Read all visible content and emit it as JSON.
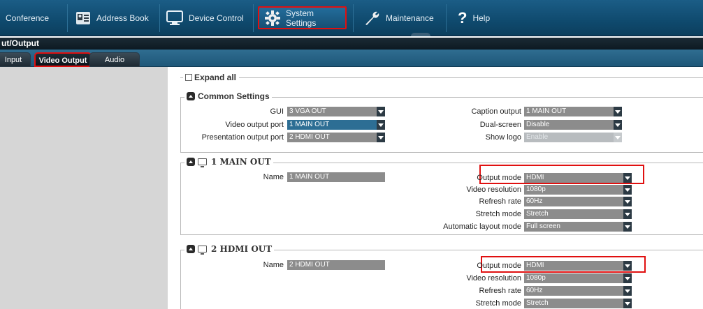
{
  "nav": {
    "conference": "Conference",
    "address_book": "Address Book",
    "device_control": "Device Control",
    "system_settings": "System Settings",
    "maintenance": "Maintenance",
    "help": "Help"
  },
  "page_title": "ut/Output",
  "tabs": {
    "input": "Input",
    "video_output": "Video Output",
    "audio": "Audio"
  },
  "expand_all": "Expand all",
  "common": {
    "legend": "Common Settings",
    "gui_label": "GUI",
    "gui_value": "3 VGA OUT",
    "video_output_port_label": "Video output port",
    "video_output_port_value": "1 MAIN OUT",
    "presentation_output_port_label": "Presentation output port",
    "presentation_output_port_value": "2 HDMI OUT",
    "caption_output_label": "Caption output",
    "caption_output_value": "1 MAIN OUT",
    "dual_screen_label": "Dual-screen",
    "dual_screen_value": "Disable",
    "show_logo_label": "Show logo",
    "show_logo_value": "Enable"
  },
  "main_out": {
    "legend": "1 MAIN OUT",
    "name_label": "Name",
    "name_value": "1 MAIN OUT",
    "output_mode_label": "Output mode",
    "output_mode_value": "HDMI",
    "video_resolution_label": "Video resolution",
    "video_resolution_value": "1080p",
    "refresh_rate_label": "Refresh rate",
    "refresh_rate_value": "60Hz",
    "stretch_mode_label": "Stretch mode",
    "stretch_mode_value": "Stretch",
    "auto_layout_label": "Automatic layout mode",
    "auto_layout_value": "Full screen"
  },
  "hdmi_out": {
    "legend": "2 HDMI OUT",
    "name_label": "Name",
    "name_value": "2 HDMI OUT",
    "output_mode_label": "Output mode",
    "output_mode_value": "HDMI",
    "video_resolution_label": "Video resolution",
    "video_resolution_value": "1080p",
    "refresh_rate_label": "Refresh rate",
    "refresh_rate_value": "60Hz",
    "stretch_mode_label": "Stretch mode",
    "stretch_mode_value": "Stretch"
  },
  "colors": {
    "nav_bg": "#0f4a6e",
    "highlight": "#e01010",
    "select_bg": "#8c8c8c",
    "select_active": "#2d6e94"
  }
}
